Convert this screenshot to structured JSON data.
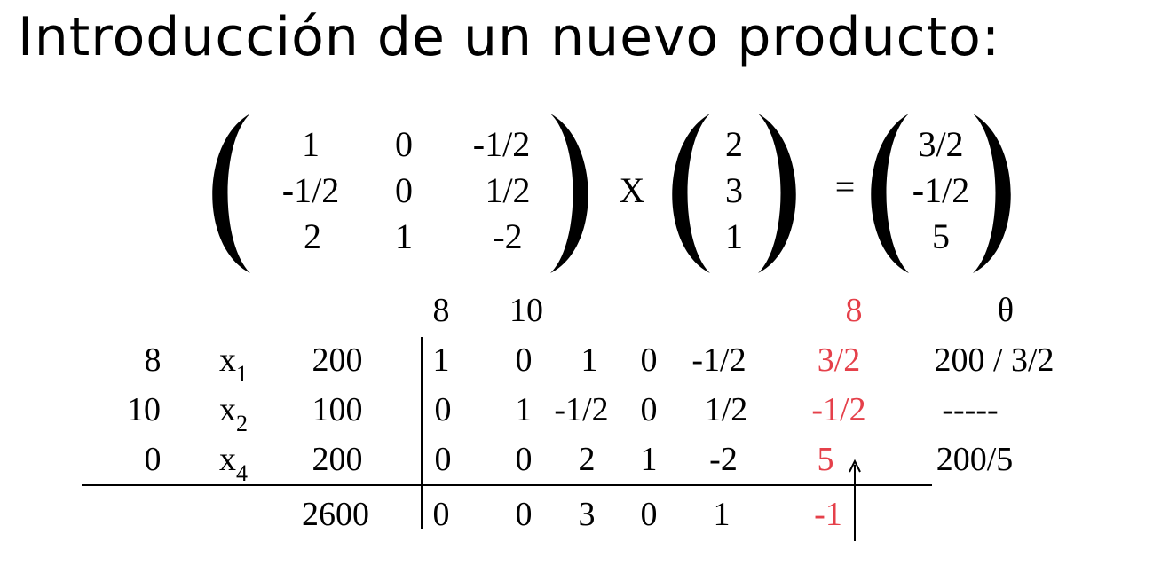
{
  "title": "Introducción de un nuevo producto:",
  "equation": {
    "matrix": [
      [
        "1",
        "0",
        "-1/2"
      ],
      [
        "-1/2",
        "0",
        "1/2"
      ],
      [
        "2",
        "1",
        "-2"
      ]
    ],
    "times": "X",
    "vector": [
      "2",
      "3",
      "1"
    ],
    "equals": "=",
    "result": [
      "3/2",
      "-1/2",
      "5"
    ]
  },
  "tableau": {
    "header": {
      "c1": "8",
      "c2": "10",
      "entering": "8",
      "theta": "θ"
    },
    "rows": [
      {
        "cb": "8",
        "var": "x",
        "sub": "1",
        "b": "200",
        "coefs": [
          "1",
          "0",
          "1",
          "0",
          "-1/2"
        ],
        "entering": "3/2",
        "ratio": "200 / 3/2"
      },
      {
        "cb": "10",
        "var": "x",
        "sub": "2",
        "b": "100",
        "coefs": [
          "0",
          "1",
          "-1/2",
          "0",
          "1/2"
        ],
        "entering": "-1/2",
        "ratio": "-----"
      },
      {
        "cb": "0",
        "var": "x",
        "sub": "4",
        "b": "200",
        "coefs": [
          "0",
          "0",
          "2",
          "1",
          "-2"
        ],
        "entering": "5",
        "ratio": "200/5"
      }
    ],
    "totals": {
      "z": "2600",
      "reduced": [
        "0",
        "0",
        "3",
        "0",
        "1"
      ],
      "entering": "-1"
    },
    "arrow": "↑"
  },
  "colors": {
    "highlight": "#e5404a"
  }
}
